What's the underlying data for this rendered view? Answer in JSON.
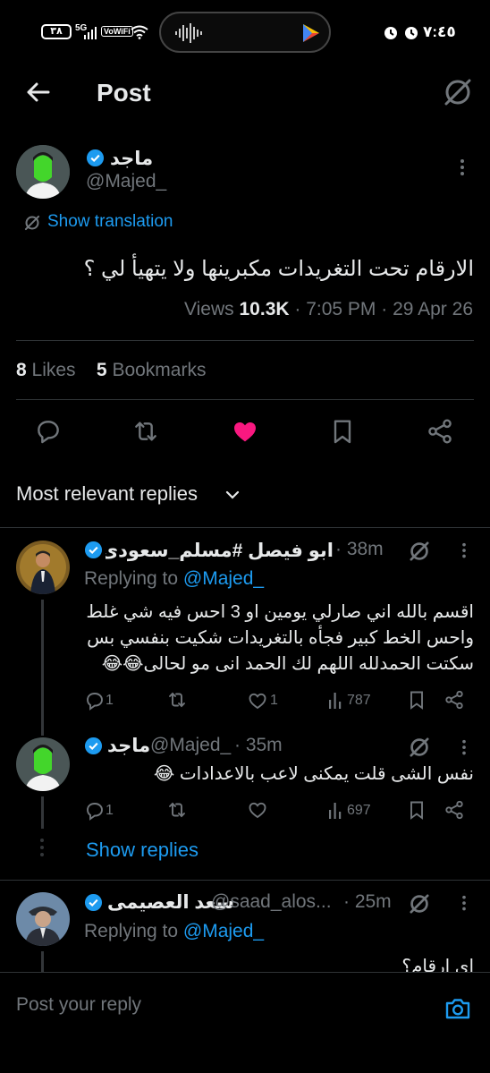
{
  "status_bar": {
    "battery": "٣٨",
    "network": "5G",
    "volte": "VoWiFi",
    "time": "٧:٤٥"
  },
  "header": {
    "title": "Post"
  },
  "post": {
    "author_name": "ماجد",
    "author_handle": "@Majed_",
    "translate_label": "Show translation",
    "text": "الارقام تحت التغريدات مكبرينها ولا يتهيأ لي ؟",
    "views_label": "Views",
    "views_count": "10.3K",
    "time": "· 7:05 PM · 29 Apr 26",
    "likes_count": "8",
    "likes_label": "Likes",
    "bookmarks_count": "5",
    "bookmarks_label": "Bookmarks",
    "liked": true,
    "like_color": "#f91880"
  },
  "sort": {
    "label": "Most relevant replies"
  },
  "replies": [
    {
      "name": "ابو فيصل #مسلم_سعودى_ه...",
      "time": "· 38m",
      "replying_prefix": "Replying to",
      "replying_handle": "@Majed_",
      "lines": [
        "اقسم بالله اني صارلي يومين او 3 احس فيه شي غلط",
        "واحس الخط كبير فجأه بالتغريدات شكيت بنفسي بس",
        "سكتت الحمدلله اللهم لك الحمد انى مو لحالى😂😂"
      ],
      "replies": "1",
      "reposts": "",
      "likes": "1",
      "views": "787"
    },
    {
      "name": "ماجد",
      "handle": "@Majed_",
      "time": "· 35m",
      "lines": [
        "نفس الشى قلت يمكنى لاعب بالاعدادات 😂"
      ],
      "replies": "1",
      "reposts": "",
      "likes": "",
      "views": "697",
      "show_replies": "Show replies"
    },
    {
      "name": "سعد العصيمى",
      "handle": "@saad_alos...",
      "time": "· 25m",
      "replying_prefix": "Replying to",
      "replying_handle": "@Majed_",
      "lines": [
        "اى ارقام؟"
      ]
    }
  ],
  "composer": {
    "placeholder": "Post your reply"
  },
  "colors": {
    "accent": "#1d9bf0",
    "background": "#000000",
    "text": "#e7e9ea",
    "muted": "#71767b",
    "like": "#f91880"
  },
  "icons": [
    "back-arrow-icon",
    "grok-icon",
    "more-icon",
    "translate-icon",
    "reply-icon",
    "repost-icon",
    "heart-icon",
    "bookmark-icon",
    "share-icon",
    "chevron-down-icon",
    "views-icon",
    "camera-icon",
    "verified-icon"
  ]
}
